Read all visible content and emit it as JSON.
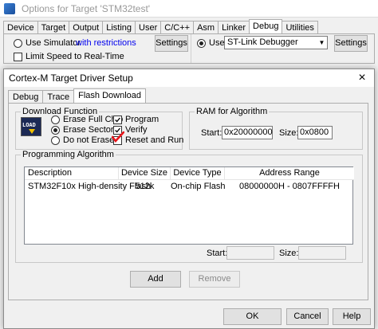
{
  "outer": {
    "title": "Options for Target 'STM32test'",
    "tabs": [
      "Device",
      "Target",
      "Output",
      "Listing",
      "User",
      "C/C++",
      "Asm",
      "Linker",
      "Debug",
      "Utilities"
    ],
    "active_tab": "Debug",
    "use_simulator_label": "Use Simulator",
    "restrictions_link": "with restrictions",
    "settings_label": "Settings",
    "limit_speed_label": "Limit Speed to Real-Time",
    "use_label": "Use:",
    "debugger_value": "ST-Link Debugger"
  },
  "dialog": {
    "title": "Cortex-M Target Driver Setup",
    "close_glyph": "×",
    "tabs": [
      "Debug",
      "Trace",
      "Flash Download"
    ],
    "active_tab": "Flash Download",
    "download_function": {
      "label": "Download Function",
      "icon_text": "LOAD",
      "erase_full_chip": "Erase Full Chip",
      "erase_sectors": "Erase Sectors",
      "do_not_erase": "Do not Erase",
      "program": "Program",
      "verify": "Verify",
      "reset_and_run": "Reset and Run"
    },
    "ram": {
      "label": "RAM for Algorithm",
      "start_label": "Start:",
      "start_value": "0x20000000",
      "size_label": "Size:",
      "size_value": "0x0800"
    },
    "algorithm": {
      "label": "Programming Algorithm",
      "columns": [
        "Description",
        "Device Size",
        "Device Type",
        "Address Range"
      ],
      "rows": [
        [
          "STM32F10x High-density Flash",
          "512k",
          "On-chip Flash",
          "08000000H - 0807FFFFH"
        ]
      ],
      "start_label": "Start:",
      "size_label": "Size:"
    },
    "add_label": "Add",
    "remove_label": "Remove",
    "ok_label": "OK",
    "cancel_label": "Cancel",
    "help_label": "Help"
  },
  "colors": {
    "red_check": "#e8151b",
    "link": "#0000ee"
  }
}
